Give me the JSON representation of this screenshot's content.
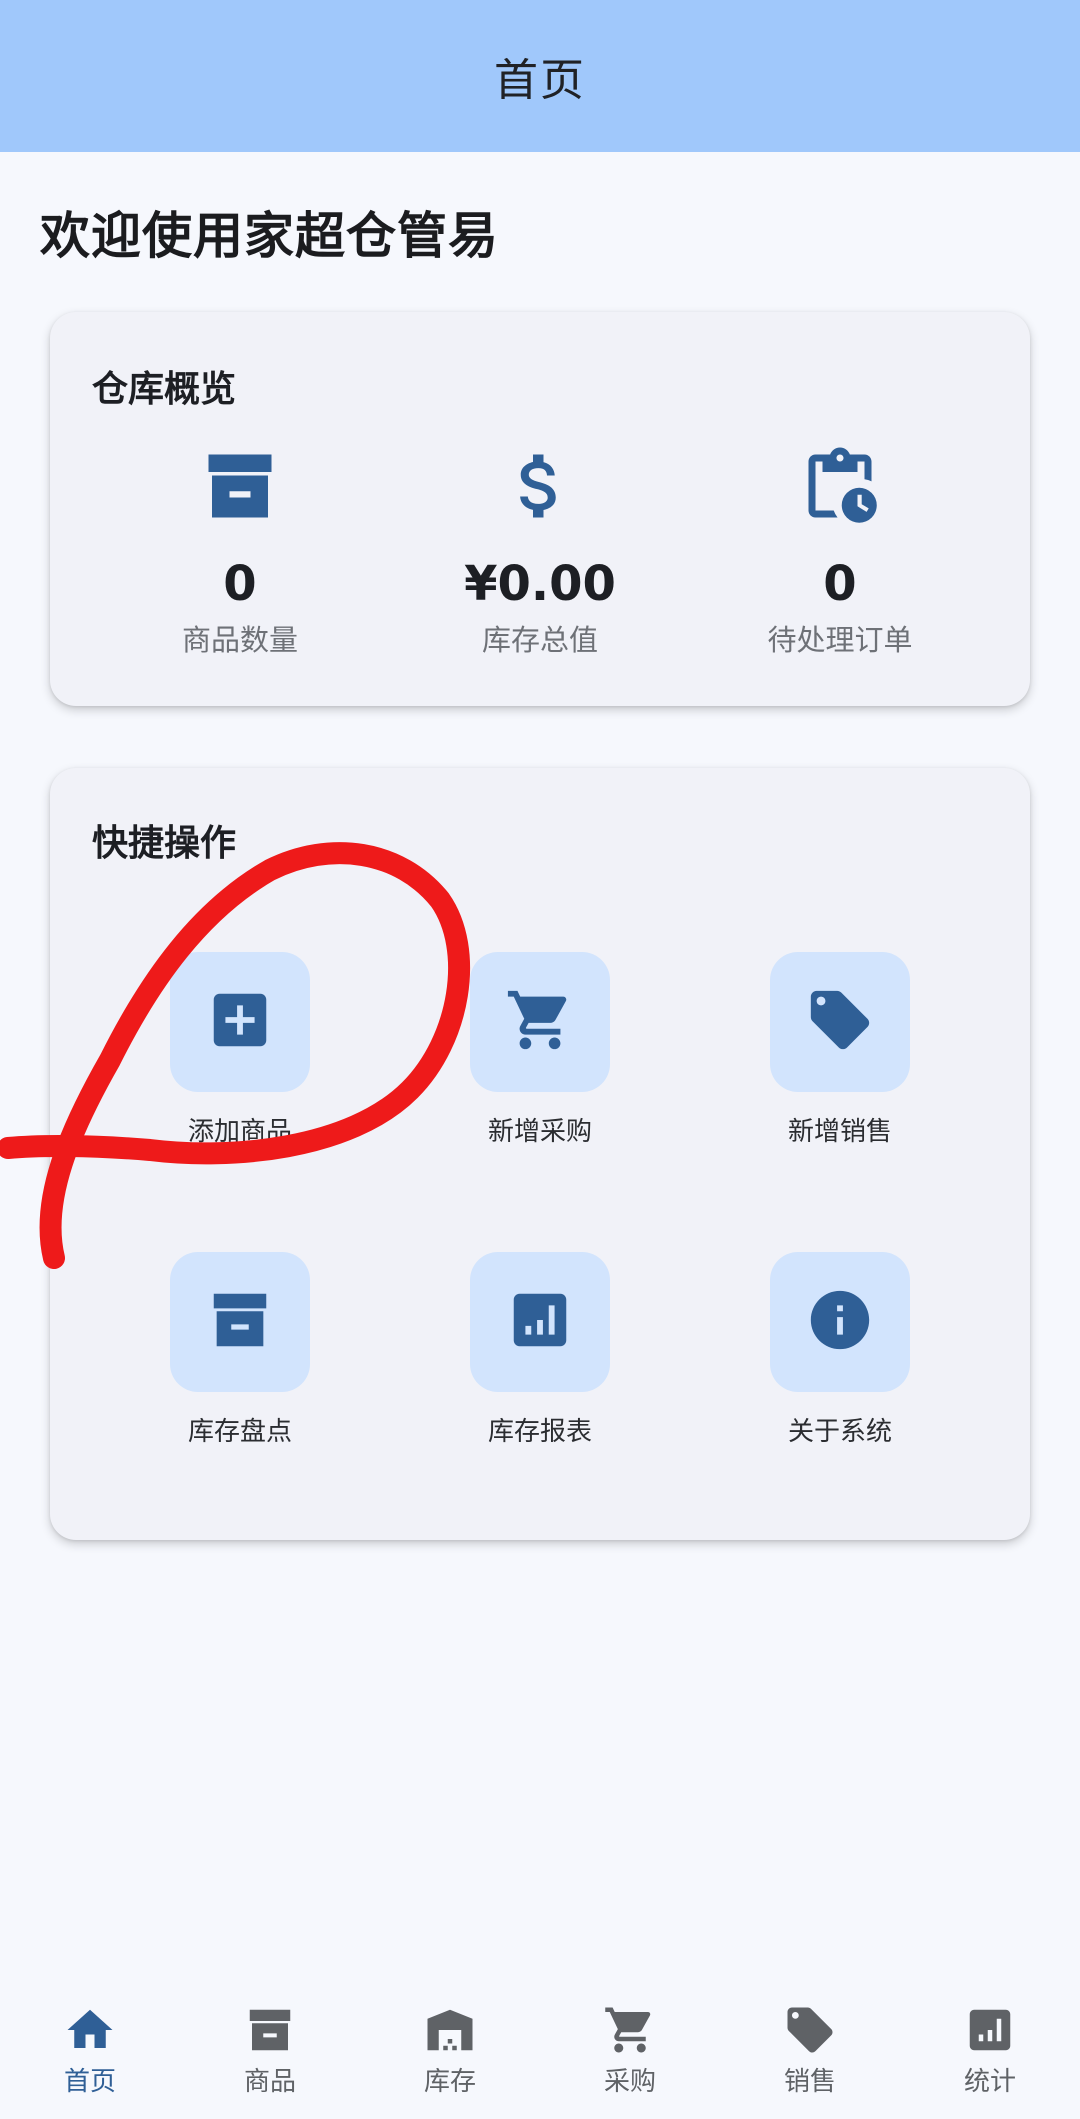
{
  "app_bar": {
    "title": "首页"
  },
  "welcome": "欢迎使用家超仓管易",
  "overview": {
    "title": "仓库概览",
    "stats": [
      {
        "icon": "inventory-box-icon",
        "value": "0",
        "label": "商品数量"
      },
      {
        "icon": "dollar-icon",
        "value": "¥0.00",
        "label": "库存总值"
      },
      {
        "icon": "pending-clipboard-icon",
        "value": "0",
        "label": "待处理订单"
      }
    ]
  },
  "quick_actions": {
    "title": "快捷操作",
    "items": [
      {
        "icon": "add-box-icon",
        "label": "添加商品"
      },
      {
        "icon": "shopping-cart-icon",
        "label": "新增采购"
      },
      {
        "icon": "tag-icon",
        "label": "新增销售"
      },
      {
        "icon": "inventory-box-icon",
        "label": "库存盘点"
      },
      {
        "icon": "bar-chart-icon",
        "label": "库存报表"
      },
      {
        "icon": "info-icon",
        "label": "关于系统"
      }
    ]
  },
  "bottom_nav": {
    "items": [
      {
        "icon": "home-icon",
        "label": "首页",
        "active": true
      },
      {
        "icon": "inventory-box-icon",
        "label": "商品",
        "active": false
      },
      {
        "icon": "warehouse-icon",
        "label": "库存",
        "active": false
      },
      {
        "icon": "shopping-cart-icon",
        "label": "采购",
        "active": false
      },
      {
        "icon": "tag-icon",
        "label": "销售",
        "active": false
      },
      {
        "icon": "bar-chart-icon",
        "label": "统计",
        "active": false
      }
    ]
  },
  "colors": {
    "app_bar": "#a0c8fb",
    "icon_primary": "#2f5f96",
    "tile_bg": "#d2e4fd",
    "nav_inactive": "#5f6266",
    "annotation": "#ee1a1a"
  }
}
